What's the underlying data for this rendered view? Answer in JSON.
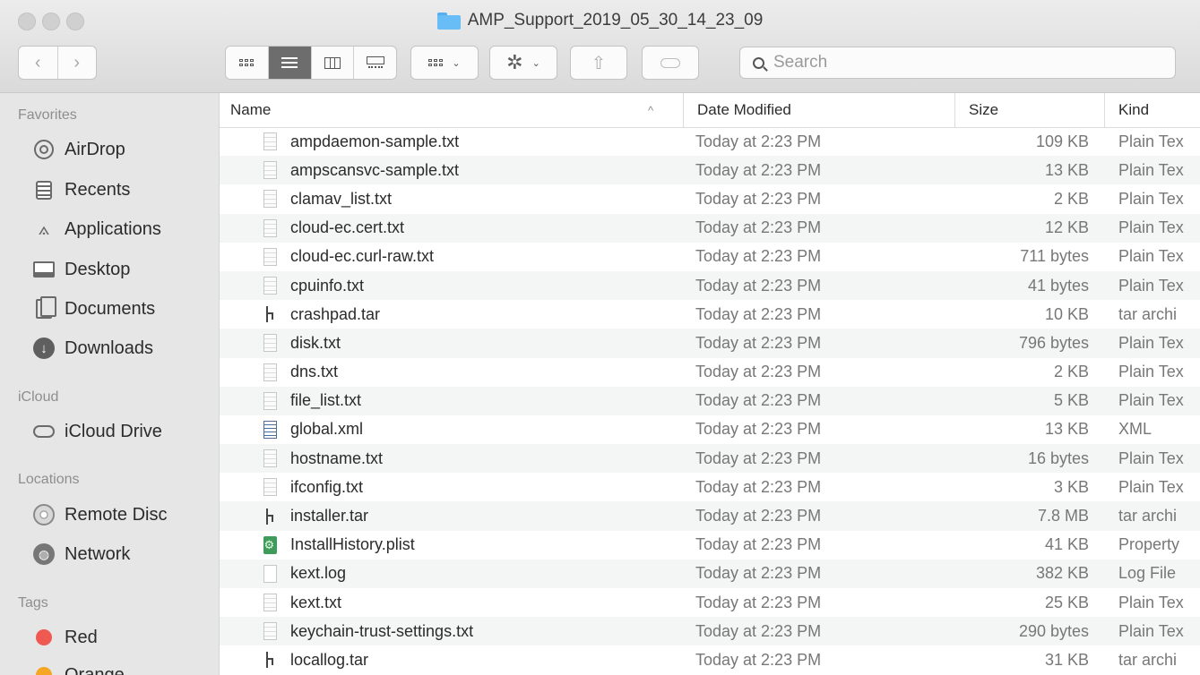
{
  "window": {
    "title": "AMP_Support_2019_05_30_14_23_09"
  },
  "toolbar": {
    "back_icon": "chevron-left-icon",
    "forward_icon": "chevron-right-icon",
    "back_glyph": "‹",
    "forward_glyph": "›",
    "share_glyph": "⇧",
    "gear_glyph": "✲",
    "chevron_glyph": "⌄",
    "views": [
      "icon-view",
      "list-view",
      "column-view",
      "gallery-view"
    ],
    "active_view": "list-view",
    "search_placeholder": "Search"
  },
  "sidebar": {
    "favorites_label": "Favorites",
    "favorites": [
      {
        "label": "AirDrop",
        "icon": "airdrop-icon"
      },
      {
        "label": "Recents",
        "icon": "recents-icon"
      },
      {
        "label": "Applications",
        "icon": "applications-icon",
        "glyph": "⟑"
      },
      {
        "label": "Desktop",
        "icon": "desktop-icon"
      },
      {
        "label": "Documents",
        "icon": "documents-icon"
      },
      {
        "label": "Downloads",
        "icon": "downloads-icon",
        "glyph": "↓"
      }
    ],
    "icloud_label": "iCloud",
    "icloud": [
      {
        "label": "iCloud Drive",
        "icon": "cloud-icon"
      }
    ],
    "locations_label": "Locations",
    "locations": [
      {
        "label": "Remote Disc",
        "icon": "disc-icon"
      },
      {
        "label": "Network",
        "icon": "globe-icon",
        "glyph": "◍"
      }
    ],
    "tags_label": "Tags",
    "tags": [
      {
        "label": "Red",
        "color": "#ee5a52"
      },
      {
        "label": "Orange",
        "color": "#f5a623"
      }
    ]
  },
  "columns": {
    "name": "Name",
    "sort_indicator": "^",
    "date": "Date Modified",
    "size": "Size",
    "kind": "Kind"
  },
  "files": [
    {
      "name": "ampdaemon-sample.txt",
      "date": "Today at 2:23 PM",
      "size": "109 KB",
      "kind": "Plain Tex",
      "type": "text"
    },
    {
      "name": "ampscansvc-sample.txt",
      "date": "Today at 2:23 PM",
      "size": "13 KB",
      "kind": "Plain Tex",
      "type": "text"
    },
    {
      "name": "clamav_list.txt",
      "date": "Today at 2:23 PM",
      "size": "2 KB",
      "kind": "Plain Tex",
      "type": "text"
    },
    {
      "name": "cloud-ec.cert.txt",
      "date": "Today at 2:23 PM",
      "size": "12 KB",
      "kind": "Plain Tex",
      "type": "text"
    },
    {
      "name": "cloud-ec.curl-raw.txt",
      "date": "Today at 2:23 PM",
      "size": "711 bytes",
      "kind": "Plain Tex",
      "type": "text"
    },
    {
      "name": "cpuinfo.txt",
      "date": "Today at 2:23 PM",
      "size": "41 bytes",
      "kind": "Plain Tex",
      "type": "text"
    },
    {
      "name": "crashpad.tar",
      "date": "Today at 2:23 PM",
      "size": "10 KB",
      "kind": "tar archi",
      "type": "tar"
    },
    {
      "name": "disk.txt",
      "date": "Today at 2:23 PM",
      "size": "796 bytes",
      "kind": "Plain Tex",
      "type": "text"
    },
    {
      "name": "dns.txt",
      "date": "Today at 2:23 PM",
      "size": "2 KB",
      "kind": "Plain Tex",
      "type": "text"
    },
    {
      "name": "file_list.txt",
      "date": "Today at 2:23 PM",
      "size": "5 KB",
      "kind": "Plain Tex",
      "type": "text"
    },
    {
      "name": "global.xml",
      "date": "Today at 2:23 PM",
      "size": "13 KB",
      "kind": "XML",
      "type": "xml"
    },
    {
      "name": "hostname.txt",
      "date": "Today at 2:23 PM",
      "size": "16 bytes",
      "kind": "Plain Tex",
      "type": "text"
    },
    {
      "name": "ifconfig.txt",
      "date": "Today at 2:23 PM",
      "size": "3 KB",
      "kind": "Plain Tex",
      "type": "text"
    },
    {
      "name": "installer.tar",
      "date": "Today at 2:23 PM",
      "size": "7.8 MB",
      "kind": "tar archi",
      "type": "tar"
    },
    {
      "name": "InstallHistory.plist",
      "date": "Today at 2:23 PM",
      "size": "41 KB",
      "kind": "Property",
      "type": "plist"
    },
    {
      "name": "kext.log",
      "date": "Today at 2:23 PM",
      "size": "382 KB",
      "kind": "Log File",
      "type": "plain"
    },
    {
      "name": "kext.txt",
      "date": "Today at 2:23 PM",
      "size": "25 KB",
      "kind": "Plain Tex",
      "type": "text"
    },
    {
      "name": "keychain-trust-settings.txt",
      "date": "Today at 2:23 PM",
      "size": "290 bytes",
      "kind": "Plain Tex",
      "type": "text"
    },
    {
      "name": "locallog.tar",
      "date": "Today at 2:23 PM",
      "size": "31 KB",
      "kind": "tar archi",
      "type": "tar"
    }
  ]
}
